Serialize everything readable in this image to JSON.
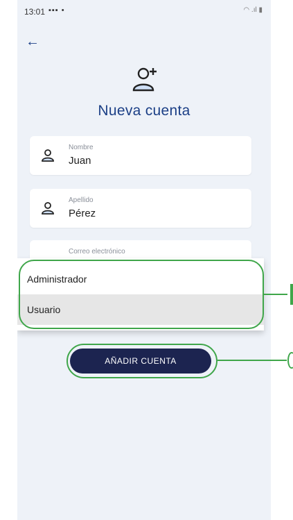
{
  "status_bar": {
    "time": "13:01",
    "notification_icons": "•"
  },
  "header": {
    "title": "Nueva cuenta"
  },
  "form": {
    "nombre": {
      "label": "Nombre",
      "value": "Juan"
    },
    "apellido": {
      "label": "Apellido",
      "value": "Pérez"
    },
    "correo": {
      "label": "Correo electrónico"
    }
  },
  "dropdown": {
    "options": [
      "Administrador",
      "Usuario"
    ],
    "selected": "Usuario"
  },
  "actions": {
    "add_account_label": "AÑADIR CUENTA"
  },
  "colors": {
    "primary": "#1b3f86",
    "button": "#1c2450",
    "highlight": "#3fa64a",
    "background": "#eef2f8"
  },
  "icons": {
    "back": "arrow-left-icon",
    "add_user": "add-user-icon",
    "person": "person-icon"
  }
}
